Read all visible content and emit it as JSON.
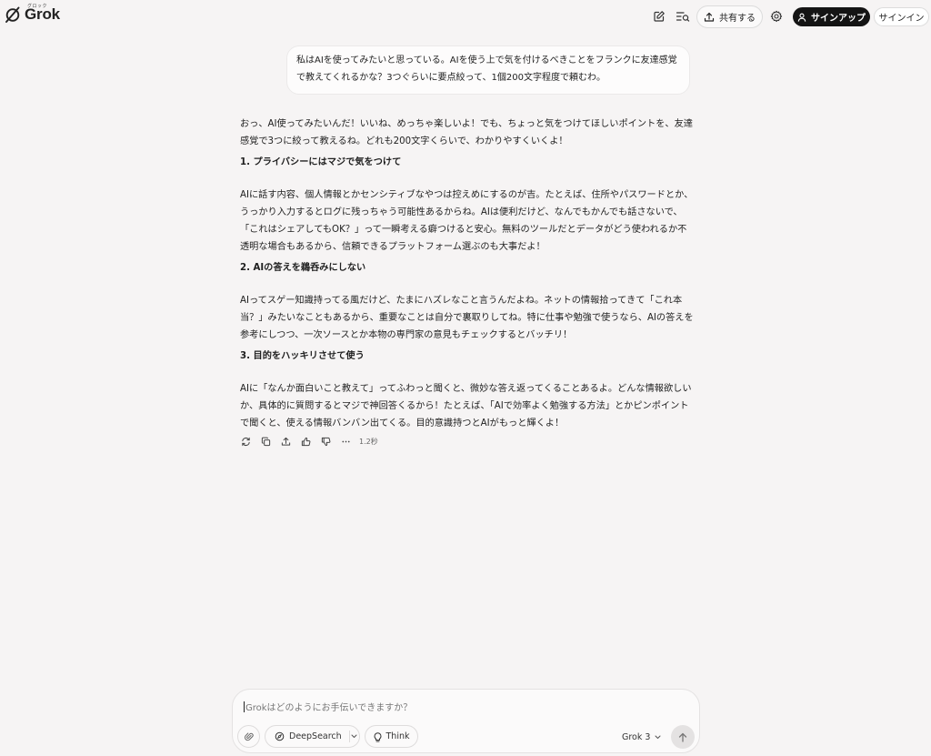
{
  "header": {
    "logo_sub": "グロック",
    "logo_text": "Grok",
    "share_label": "共有する",
    "signup_label": "サインアップ",
    "signin_label": "サインイン",
    "icons": [
      "new-chat-icon",
      "history-search-icon",
      "share-icon",
      "settings-icon",
      "user-icon"
    ]
  },
  "user_message": "私はAIを使ってみたいと思っている。AIを使う上で気を付けるべきことをフランクに友達感覚で教えてくれるかな？3つぐらいに要点絞って、1個200文字程度で頼むわ。",
  "assistant": {
    "intro": "おっ、AI使ってみたいんだ！いいね、めっちゃ楽しいよ！でも、ちょっと気をつけてほしいポイントを、友達感覚で3つに絞って教えるね。どれも200文字くらいで、わかりやすくいくよ！",
    "sections": [
      {
        "heading": "1. プライバシーにはマジで気をつけて",
        "body": "AIに話す内容、個人情報とかセンシティブなやつは控えめにするのが吉。たとえば、住所やパスワードとか、うっかり入力するとログに残っちゃう可能性あるからね。AIは便利だけど、なんでもかんでも話さないで、「これはシェアしてもOK？」って一瞬考える癖つけると安心。無料のツールだとデータがどう使われるか不透明な場合もあるから、信頼できるプラットフォーム選ぶのも大事だよ！"
      },
      {
        "heading": "2. AIの答えを鵜呑みにしない",
        "body": "AIってスゲー知識持ってる風だけど、たまにハズレなこと言うんだよね。ネットの情報拾ってきて「これ本当？」みたいなこともあるから、重要なことは自分で裏取りしてね。特に仕事や勉強で使うなら、AIの答えを参考にしつつ、一次ソースとか本物の専門家の意見もチェックするとバッチリ！"
      },
      {
        "heading": "3. 目的をハッキリさせて使う",
        "body": "AIに「なんか面白いこと教えて」ってふわっと聞くと、微妙な答え返ってくることあるよ。どんな情報欲しいか、具体的に質問するとマジで神回答くるから！たとえば、「AIで効率よく勉強する方法」とかピンポイントで聞くと、使える情報バンバン出てくる。目的意識持つとAIがもっと輝くよ！"
      }
    ],
    "actions": [
      "regenerate-icon",
      "copy-icon",
      "share-icon",
      "thumbs-up-icon",
      "thumbs-down-icon",
      "more-icon"
    ],
    "response_time": "1.2秒"
  },
  "composer": {
    "placeholder": "Grokはどのようにお手伝いできますか？",
    "deepsearch_label": "DeepSearch",
    "think_label": "Think",
    "model_label": "Grok 3"
  }
}
